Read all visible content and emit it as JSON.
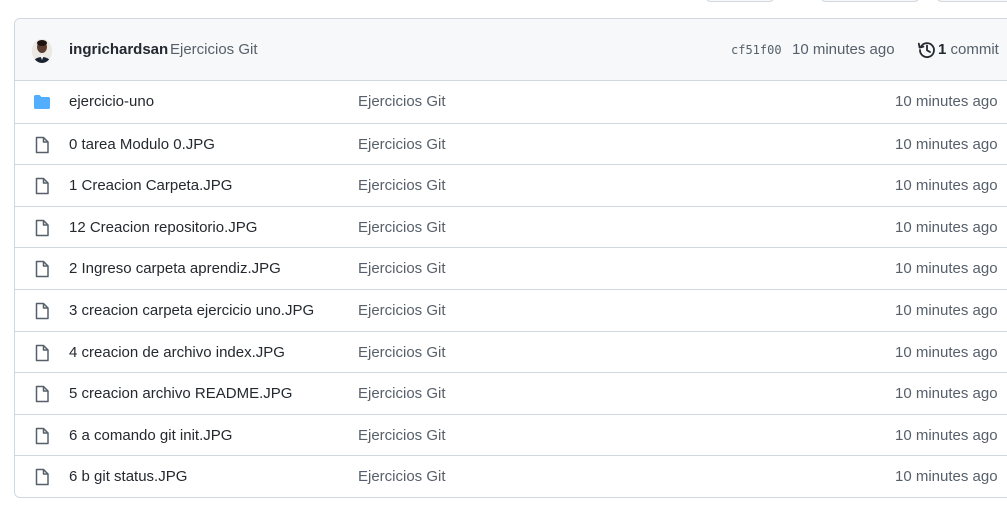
{
  "header": {
    "author": "ingrichardsan",
    "commit_message": "Ejercicios Git",
    "sha": "cf51f00",
    "time_ago": "10 minutes ago",
    "commit_count": "1",
    "commit_label": "commit"
  },
  "colors": {
    "folder": "#54aeff",
    "file_icon": "#57606a",
    "border": "#d0d7de",
    "header_bg": "#f6f8fa"
  },
  "files": [
    {
      "name": "ejercicio-uno",
      "type": "folder",
      "icon": "folder-icon",
      "message": "Ejercicios Git",
      "time": "10 minutes ago"
    },
    {
      "name": "0 tarea Modulo 0.JPG",
      "type": "file",
      "icon": "file-icon",
      "message": "Ejercicios Git",
      "time": "10 minutes ago"
    },
    {
      "name": "1 Creacion Carpeta.JPG",
      "type": "file",
      "icon": "file-icon",
      "message": "Ejercicios Git",
      "time": "10 minutes ago"
    },
    {
      "name": "12 Creacion repositorio.JPG",
      "type": "file",
      "icon": "file-icon",
      "message": "Ejercicios Git",
      "time": "10 minutes ago"
    },
    {
      "name": "2 Ingreso carpeta aprendiz.JPG",
      "type": "file",
      "icon": "file-icon",
      "message": "Ejercicios Git",
      "time": "10 minutes ago"
    },
    {
      "name": "3 creacion carpeta ejercicio uno.JPG",
      "type": "file",
      "icon": "file-icon",
      "message": "Ejercicios Git",
      "time": "10 minutes ago"
    },
    {
      "name": "4 creacion de archivo index.JPG",
      "type": "file",
      "icon": "file-icon",
      "message": "Ejercicios Git",
      "time": "10 minutes ago"
    },
    {
      "name": "5 creacion archivo README.JPG",
      "type": "file",
      "icon": "file-icon",
      "message": "Ejercicios Git",
      "time": "10 minutes ago"
    },
    {
      "name": "6 a comando git init.JPG",
      "type": "file",
      "icon": "file-icon",
      "message": "Ejercicios Git",
      "time": "10 minutes ago"
    },
    {
      "name": "6 b git status.JPG",
      "type": "file",
      "icon": "file-icon",
      "message": "Ejercicios Git",
      "time": "10 minutes ago"
    }
  ]
}
